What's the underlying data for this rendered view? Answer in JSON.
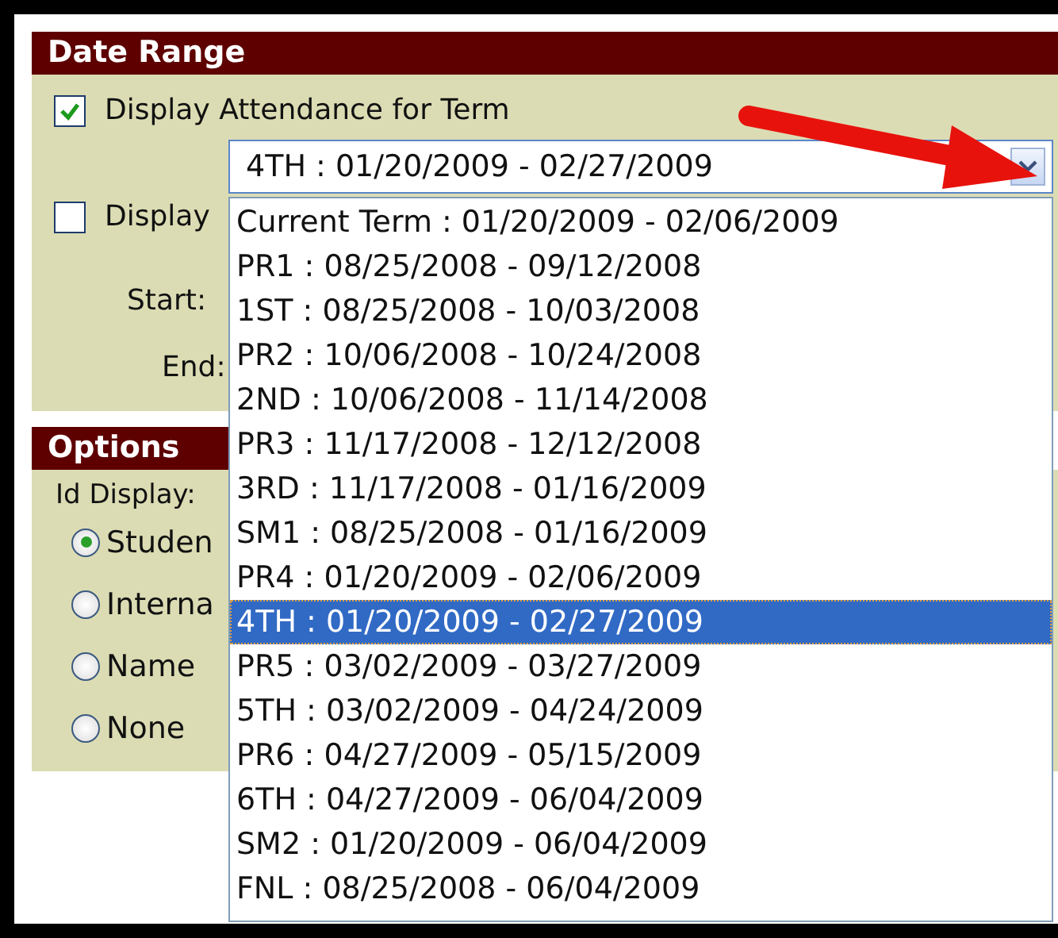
{
  "date_range": {
    "title": "Date Range",
    "term_checkbox": {
      "label": "Display Attendance for Term",
      "checked": true
    },
    "term_select": {
      "value": "4TH : 01/20/2009 - 02/27/2009",
      "expanded": true
    },
    "dates_checkbox": {
      "label": "Display",
      "checked": false
    },
    "start_label": "Start:",
    "end_label": "End:"
  },
  "term_options": [
    {
      "label": "Current Term : 01/20/2009 - 02/06/2009",
      "selected": false
    },
    {
      "label": "PR1 : 08/25/2008 - 09/12/2008",
      "selected": false
    },
    {
      "label": "1ST : 08/25/2008 - 10/03/2008",
      "selected": false
    },
    {
      "label": "PR2 : 10/06/2008 - 10/24/2008",
      "selected": false
    },
    {
      "label": "2ND : 10/06/2008 - 11/14/2008",
      "selected": false
    },
    {
      "label": "PR3 : 11/17/2008 - 12/12/2008",
      "selected": false
    },
    {
      "label": "3RD : 11/17/2008 - 01/16/2009",
      "selected": false
    },
    {
      "label": "SM1 : 08/25/2008 - 01/16/2009",
      "selected": false
    },
    {
      "label": "PR4 : 01/20/2009 - 02/06/2009",
      "selected": false
    },
    {
      "label": "4TH : 01/20/2009 - 02/27/2009",
      "selected": true
    },
    {
      "label": "PR5 : 03/02/2009 - 03/27/2009",
      "selected": false
    },
    {
      "label": "5TH : 03/02/2009 - 04/24/2009",
      "selected": false
    },
    {
      "label": "PR6 : 04/27/2009 - 05/15/2009",
      "selected": false
    },
    {
      "label": "6TH : 04/27/2009 - 06/04/2009",
      "selected": false
    },
    {
      "label": "SM2 : 01/20/2009 - 06/04/2009",
      "selected": false
    },
    {
      "label": "FNL : 08/25/2008 - 06/04/2009",
      "selected": false
    }
  ],
  "options": {
    "title": "Options",
    "id_display_label": "Id Display:",
    "radios": [
      {
        "label": "Studen",
        "selected": true
      },
      {
        "label": "Interna",
        "selected": false
      },
      {
        "label": "Name",
        "selected": false
      },
      {
        "label": "None",
        "selected": false
      }
    ]
  }
}
